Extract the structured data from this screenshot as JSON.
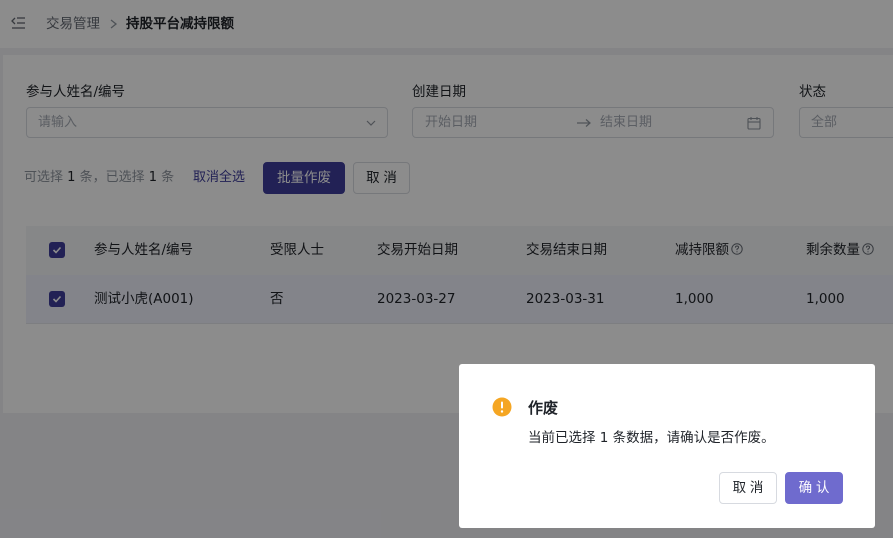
{
  "breadcrumb": {
    "parent": "交易管理",
    "current": "持股平台减持限额"
  },
  "filters": {
    "participant": {
      "label": "参与人姓名/编号",
      "placeholder": "请输入"
    },
    "created_date": {
      "label": "创建日期",
      "start_placeholder": "开始日期",
      "end_placeholder": "结束日期"
    },
    "status": {
      "label": "状态",
      "value": "全部"
    }
  },
  "selection": {
    "prefix_selectable": "可选择",
    "selectable_count": "1",
    "unit_1": "条，已选择",
    "selected_count": "1",
    "unit_2": "条",
    "clear_all": "取消全选"
  },
  "toolbar": {
    "batch_void": "批量作废",
    "cancel": "取 消"
  },
  "table": {
    "columns": [
      "参与人姓名/编号",
      "受限人士",
      "交易开始日期",
      "交易结束日期",
      "减持限额",
      "剩余数量"
    ],
    "rows": [
      [
        "测试小虎(A001)",
        "否",
        "2023-03-27",
        "2023-03-31",
        "1,000",
        "1,000"
      ]
    ]
  },
  "dialog": {
    "title": "作废",
    "content": "当前已选择 1 条数据，请确认是否作废。",
    "cancel": "取 消",
    "confirm": "确 认"
  },
  "colors": {
    "primary": "#3e3c9b",
    "confirm_button": "#6f6bce",
    "warning": "#f5a623"
  }
}
